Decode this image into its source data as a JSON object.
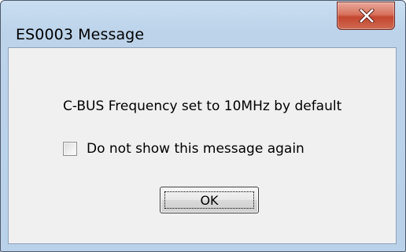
{
  "window": {
    "title": "ES0003 Message",
    "close_icon": "close-icon"
  },
  "dialog": {
    "message": "C-BUS Frequency set to 10MHz by default",
    "checkbox_label": "Do not show this message again",
    "checkbox_checked": false,
    "ok_label": "OK"
  },
  "colors": {
    "close_button": "#c4462f",
    "client_background": "#f0f0f0",
    "frame": "#b9d1e9"
  }
}
